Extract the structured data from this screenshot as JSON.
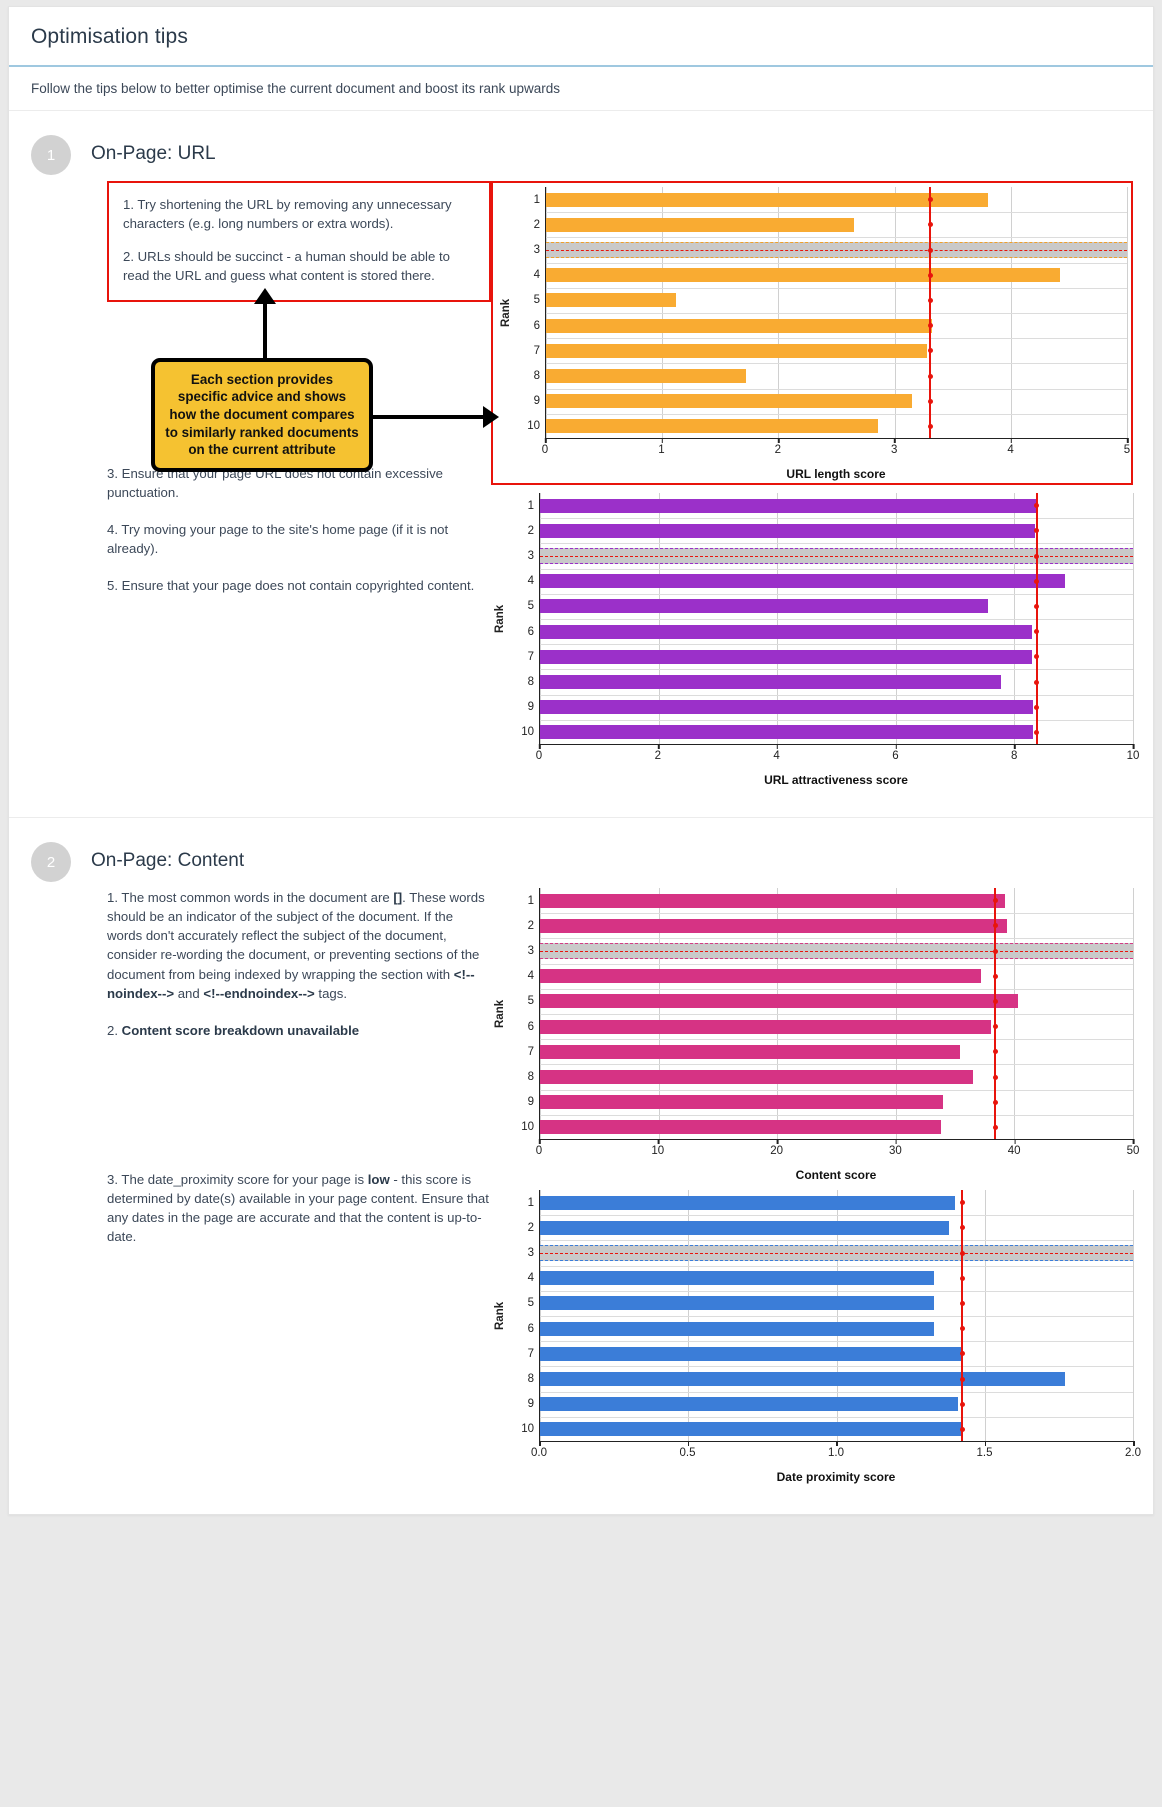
{
  "header": {
    "title": "Optimisation tips",
    "subtitle": "Follow the tips below to better optimise the current document and boost its rank upwards"
  },
  "callout": {
    "text": "Each section provides specific advice and shows how the document compares to similarly ranked documents on the current attribute"
  },
  "sections": [
    {
      "number": "1",
      "title": "On-Page: URL",
      "boxed_tips": [
        "1. Try shortening the URL by removing any unnecessary characters (e.g. long numbers or extra words).",
        "2. URLs should be succinct - a human should be able to read the URL and guess what content is stored there."
      ],
      "plain_tips": [
        "3. Ensure that your page URL does not contain excessive punctuation.",
        "4. Try moving your page to the site's home page (if it is not already).",
        "5. Ensure that your page does not contain copyrighted content."
      ]
    },
    {
      "number": "2",
      "title": "On-Page: Content",
      "tip1_parts": [
        {
          "t": "1. The most common words in the document are ",
          "b": false
        },
        {
          "t": "[]",
          "b": true
        },
        {
          "t": ". These words should be an indicator of the subject of the document. If the words don't accurately reflect the subject of the document, consider re-wording the document, or preventing sections of the document from being indexed by wrapping the section with ",
          "b": false
        },
        {
          "t": "<!--noindex-->",
          "b": true
        },
        {
          "t": " and ",
          "b": false
        },
        {
          "t": "<!--endnoindex-->",
          "b": true
        },
        {
          "t": " tags.",
          "b": false
        }
      ],
      "tip2_parts": [
        {
          "t": "2. ",
          "b": false
        },
        {
          "t": "Content score breakdown unavailable",
          "b": true
        }
      ],
      "tip3_parts": [
        {
          "t": "3. The date_proximity score for your page is ",
          "b": false
        },
        {
          "t": "low",
          "b": true
        },
        {
          "t": " - this score is determined by date(s) available in your page content. Ensure that any dates in the page are accurate and that the content is up-to-date.",
          "b": false
        }
      ]
    }
  ],
  "chart_data": [
    {
      "type": "bar",
      "id": "url-length",
      "title": "URL length score",
      "xlabel": "URL length score",
      "ylabel": "Rank",
      "orientation": "horizontal",
      "color": "#f9ab32",
      "categories": [
        "1",
        "2",
        "3",
        "4",
        "5",
        "6",
        "7",
        "8",
        "9",
        "10"
      ],
      "values": [
        3.8,
        2.65,
        null,
        4.42,
        1.12,
        3.32,
        3.28,
        1.72,
        3.15,
        2.86
      ],
      "xlim": [
        0,
        5
      ],
      "xticks": [
        0,
        1,
        2,
        3,
        4,
        5
      ],
      "selected_rank": "3",
      "selected_marker_value": 3.3,
      "reference_line_value": 3.3,
      "grid": true,
      "highlighted": true
    },
    {
      "type": "bar",
      "id": "url-attractiveness",
      "title": "URL attractiveness score",
      "xlabel": "URL attractiveness score",
      "ylabel": "Rank",
      "orientation": "horizontal",
      "color": "#9b30c9",
      "categories": [
        "1",
        "2",
        "3",
        "4",
        "5",
        "6",
        "7",
        "8",
        "9",
        "10"
      ],
      "values": [
        8.38,
        8.34,
        null,
        8.86,
        7.55,
        8.3,
        8.3,
        7.77,
        8.32,
        8.32
      ],
      "xlim": [
        0,
        10
      ],
      "xticks": [
        0,
        2,
        4,
        6,
        8,
        10
      ],
      "selected_rank": "3",
      "selected_marker_value": 8.36,
      "reference_line_value": 8.36,
      "grid": true,
      "highlighted": false
    },
    {
      "type": "bar",
      "id": "content-score",
      "title": "Content score",
      "xlabel": "Content score",
      "ylabel": "Rank",
      "orientation": "horizontal",
      "color": "#d63384",
      "categories": [
        "1",
        "2",
        "3",
        "4",
        "5",
        "6",
        "7",
        "8",
        "9",
        "10"
      ],
      "values": [
        39.2,
        39.4,
        null,
        37.2,
        40.3,
        38.0,
        35.4,
        36.5,
        34.0,
        33.8
      ],
      "xlim": [
        0,
        50
      ],
      "xticks": [
        0,
        10,
        20,
        30,
        40,
        50
      ],
      "selected_rank": "3",
      "selected_marker_value": 38.3,
      "reference_line_value": 38.3,
      "grid": true,
      "highlighted": false
    },
    {
      "type": "bar",
      "id": "date-proximity",
      "title": "Date proximity score",
      "xlabel": "Date proximity score",
      "ylabel": "Rank",
      "orientation": "horizontal",
      "color": "#3b7dd8",
      "categories": [
        "1",
        "2",
        "3",
        "4",
        "5",
        "6",
        "7",
        "8",
        "9",
        "10"
      ],
      "values": [
        1.4,
        1.38,
        null,
        1.33,
        1.33,
        1.33,
        1.42,
        1.77,
        1.41,
        1.42
      ],
      "xlim": [
        0,
        2
      ],
      "xticks": [
        "0.0",
        "0.5",
        "1.0",
        "1.5",
        "2.0"
      ],
      "xtick_values": [
        0,
        0.5,
        1.0,
        1.5,
        2.0
      ],
      "selected_rank": "3",
      "selected_marker_value": 1.42,
      "reference_line_value": 1.42,
      "grid": true,
      "highlighted": false
    }
  ]
}
